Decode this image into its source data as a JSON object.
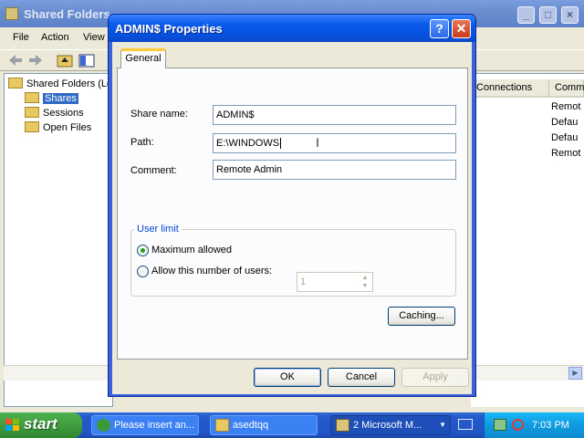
{
  "main_window": {
    "title": "Shared Folders",
    "menu": [
      "File",
      "Action",
      "View"
    ],
    "tree": {
      "root": "Shared Folders (Lo",
      "items": [
        "Shares",
        "Sessions",
        "Open Files"
      ],
      "selected": "Shares"
    },
    "columns": [
      "Connections",
      "Comm"
    ],
    "comment_cells": [
      "Remot",
      "Defau",
      "Defau",
      "Remot"
    ]
  },
  "dialog": {
    "title": "ADMIN$ Properties",
    "tab": "General",
    "share_name_label": "Share name:",
    "share_name_value": "ADMIN$",
    "path_label": "Path:",
    "path_value": "E:\\WINDOWS",
    "comment_label": "Comment:",
    "comment_value": "Remote Admin",
    "user_limit_legend": "User limit",
    "radio_max": "Maximum allowed",
    "radio_allow": "Allow this number of users:",
    "selected_radio": "Maximum allowed",
    "users_value": "1",
    "caching_button": "Caching...",
    "ok_button": "OK",
    "cancel_button": "Cancel",
    "apply_button": "Apply"
  },
  "taskbar": {
    "start": "start",
    "tasks": [
      "Please insert an...",
      "asedtqq",
      "2 Microsoft M..."
    ],
    "clock": "7:03 PM"
  },
  "colors": {
    "titlebar_active": "#0553e0",
    "titlebar_inactive": "#7a9ee0",
    "dialog_face": "#ece9d8",
    "group_legend": "#0046d5",
    "start_green": "#3c9a3c",
    "taskbar_blue": "#2459cc",
    "tray_blue": "#0f9be0"
  }
}
